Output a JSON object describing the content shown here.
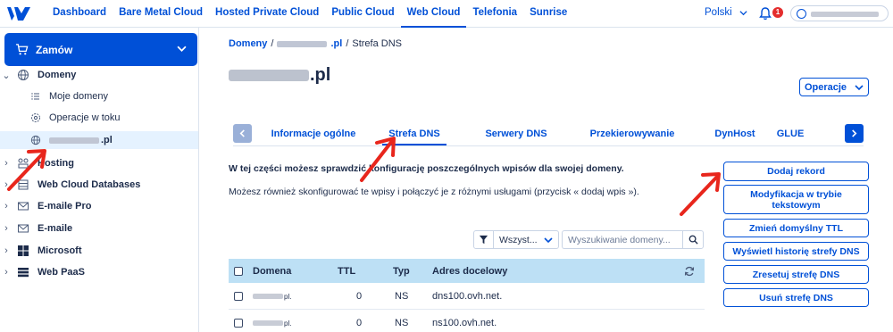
{
  "nav": {
    "links": [
      "Dashboard",
      "Bare Metal Cloud",
      "Hosted Private Cloud",
      "Public Cloud",
      "Web Cloud",
      "Telefonia",
      "Sunrise"
    ],
    "active": "Web Cloud",
    "language": "Polski",
    "notifications_count": "1"
  },
  "sidebar": {
    "order_label": "Zamów",
    "domains_label": "Domeny",
    "sub": {
      "my_domains": "Moje domeny",
      "operations": "Operacje w toku",
      "domain_suffix": ".pl"
    },
    "items": {
      "hosting": "Hosting",
      "databases": "Web Cloud Databases",
      "email_pro": "E-maile Pro",
      "email": "E-maile",
      "microsoft": "Microsoft",
      "webpaas": "Web PaaS"
    }
  },
  "breadcrumb": {
    "root": "Domeny",
    "sep": "/",
    "domain_suffix": ".pl",
    "current": "Strefa DNS"
  },
  "page": {
    "title_suffix": ".pl",
    "operations_label": "Operacje"
  },
  "tabs": [
    "Informacje ogólne",
    "Strefa DNS",
    "Serwery DNS",
    "Przekierowywanie",
    "DynHost",
    "GLUE"
  ],
  "active_tab": "Strefa DNS",
  "description": {
    "line1": "W tej części możesz sprawdzić konfigurację poszczególnych wpisów dla swojej domeny.",
    "line2": "Możesz również skonfigurować te wpisy i połączyć je z różnymi usługami (przycisk « dodaj wpis »)."
  },
  "actions": {
    "add_record": "Dodaj rekord",
    "text_mode": "Modyfikacja w trybie tekstowym",
    "change_ttl": "Zmień domyślny TTL",
    "history": "Wyświetl historię strefy DNS",
    "reset": "Zresetuj strefę DNS",
    "delete": "Usuń strefę DNS"
  },
  "filter": {
    "label": "Wszyst...",
    "search_placeholder": "Wyszukiwanie domeny..."
  },
  "table": {
    "columns": [
      "Domena",
      "TTL",
      "Typ",
      "Adres docelowy"
    ],
    "rows": [
      {
        "domain_suffix": "pl.",
        "ttl": "0",
        "type": "NS",
        "target": "dns100.ovh.net."
      },
      {
        "domain_suffix": "pl.",
        "ttl": "0",
        "type": "NS",
        "target": "ns100.ovh.net."
      }
    ]
  },
  "colors": {
    "accent": "#0050d7",
    "table_header": "#bde0f5",
    "selected_bg": "#e5f2ff",
    "annotation_arrow": "#e8261c"
  }
}
